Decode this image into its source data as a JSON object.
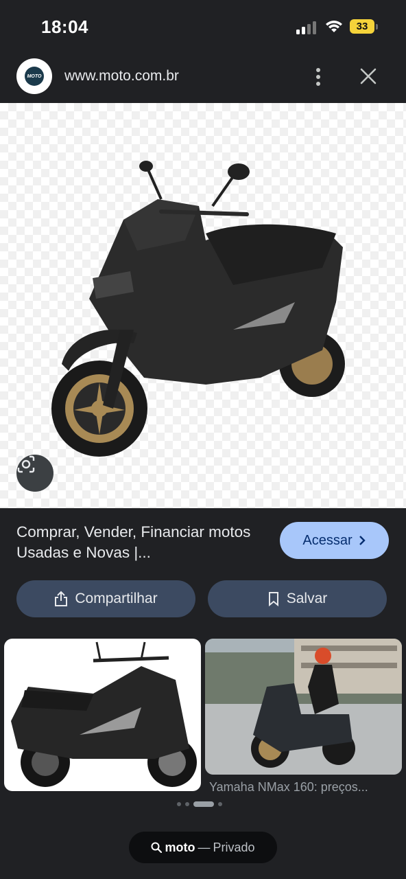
{
  "status_bar": {
    "time": "18:04",
    "battery": "33"
  },
  "browser": {
    "url": "www.moto.com.br",
    "favicon_text": "MOTO"
  },
  "result": {
    "title": "Comprar, Vender, Financiar motos Usadas e Novas |...",
    "access_label": "Acessar",
    "share_label": "Compartilhar",
    "save_label": "Salvar"
  },
  "related": [
    {
      "caption": ""
    },
    {
      "caption": "Yamaha NMax 160: preços..."
    }
  ],
  "pager": {
    "count": 4,
    "active": 2
  },
  "search_pill": {
    "query": "moto",
    "separator": "—",
    "mode": "Privado"
  },
  "icons": [
    "signal-icon",
    "wifi-icon",
    "battery-icon",
    "favicon-icon",
    "more-vert-icon",
    "close-icon",
    "lens-icon",
    "chevron-right-icon",
    "share-icon",
    "bookmark-icon",
    "search-icon"
  ],
  "colors": {
    "background": "#202124",
    "accent": "#a8c7fa",
    "button": "#3c4a61",
    "battery": "#f5d33a"
  }
}
